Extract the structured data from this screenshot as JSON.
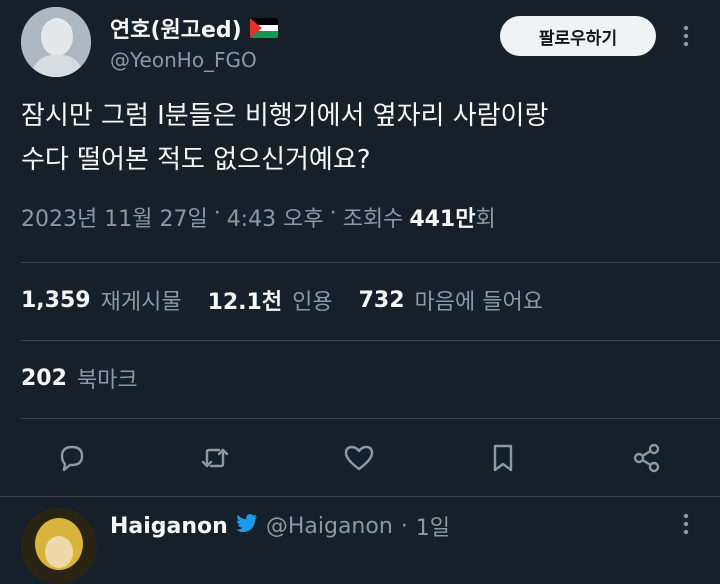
{
  "author": {
    "name": "연호(원고ed)",
    "handle": "@YeonHo_FGO",
    "flag_icon": "palestine-flag-icon"
  },
  "follow_button": {
    "label": "팔로우하기"
  },
  "tweet": {
    "line1": "잠시만 그럼 I분들은 비행기에서 옆자리 사람이랑",
    "line2": "수다 떨어본 적도 없으신거예요?"
  },
  "meta": {
    "date": "2023년 11월 27일",
    "sep1": "·",
    "time": "4:43 오후",
    "sep2": "·",
    "views_label": "조회수",
    "views_count": "441만",
    "views_suffix": "회"
  },
  "stats": {
    "retweets": {
      "count": "1,359",
      "label": "재게시물"
    },
    "quotes": {
      "count": "12.1천",
      "label": "인용"
    },
    "likes": {
      "count": "732",
      "label": "마음에 들어요"
    }
  },
  "bookmarks": {
    "count": "202",
    "label": "북마크"
  },
  "reply": {
    "name": "Haiganon",
    "handle": "@Haiganon",
    "sep": "·",
    "time": "1일"
  },
  "colors": {
    "background": "#15202b",
    "text": "#f7f9f9",
    "secondary": "#8b98a5",
    "divider": "#38444d",
    "follow_bg": "#eff3f4"
  },
  "icons": [
    "reply-icon",
    "retweet-icon",
    "like-icon",
    "bookmark-icon",
    "share-icon",
    "more-icon",
    "verified-icon"
  ]
}
